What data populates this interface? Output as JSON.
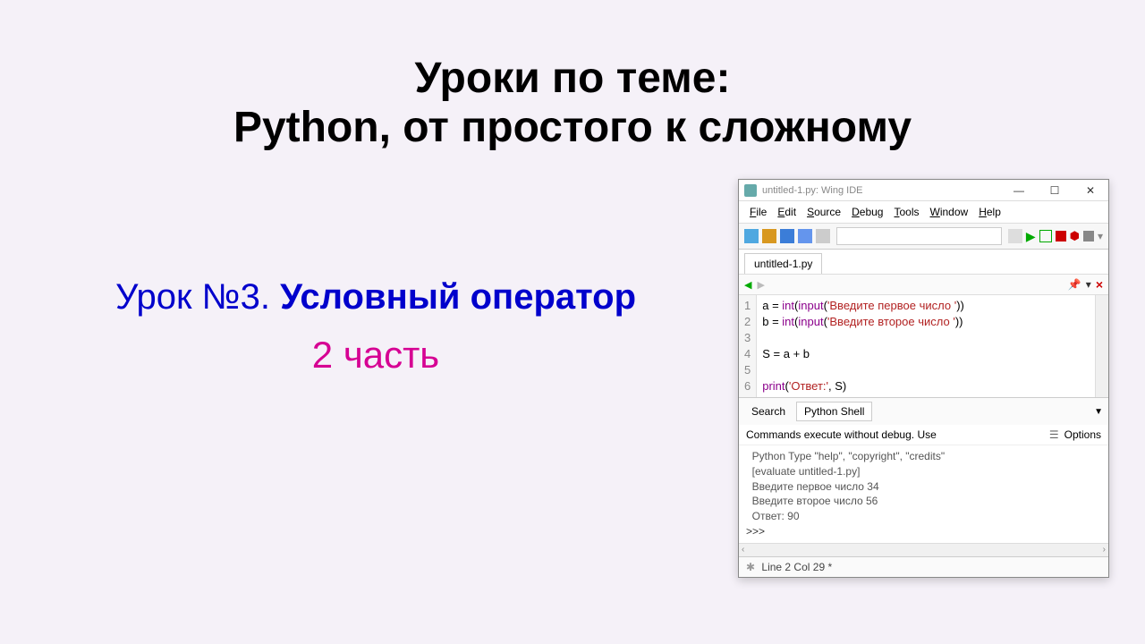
{
  "slide": {
    "title_line1": "Уроки по теме:",
    "title_line2": "Python, от простого к сложному",
    "lesson_number": "Урок №3.",
    "lesson_title": "Условный оператор",
    "lesson_part": "2 часть"
  },
  "ide": {
    "window_title": "untitled-1.py: Wing IDE",
    "menu": [
      "File",
      "Edit",
      "Source",
      "Debug",
      "Tools",
      "Window",
      "Help"
    ],
    "file_tab": "untitled-1.py",
    "code": {
      "lines": [
        {
          "n": "1",
          "html": "a = <span class='kw'>int</span>(<span class='kw'>input</span>(<span class='str'>'Введите первое число '</span>))"
        },
        {
          "n": "2",
          "html": "b = <span class='kw'>int</span>(<span class='kw'>input</span>(<span class='str'>'Введите второе число '</span>))"
        },
        {
          "n": "3",
          "html": ""
        },
        {
          "n": "4",
          "html": "S = a + b"
        },
        {
          "n": "5",
          "html": ""
        },
        {
          "n": "6",
          "html": "<span class='kw'>print</span>(<span class='str'>'Ответ:'</span>, S)"
        }
      ]
    },
    "panel_tabs": {
      "search": "Search",
      "shell": "Python Shell"
    },
    "shell_header": {
      "text": "Commands execute without debug.  Use",
      "options": "Options"
    },
    "shell_output": [
      "Python Type \"help\", \"copyright\", \"credits\"",
      "[evaluate untitled-1.py]",
      "Введите первое число 34",
      "Введите второе число 56",
      "Ответ: 90"
    ],
    "shell_prompt": ">>> ",
    "statusbar": "Line 2 Col 29 *"
  }
}
